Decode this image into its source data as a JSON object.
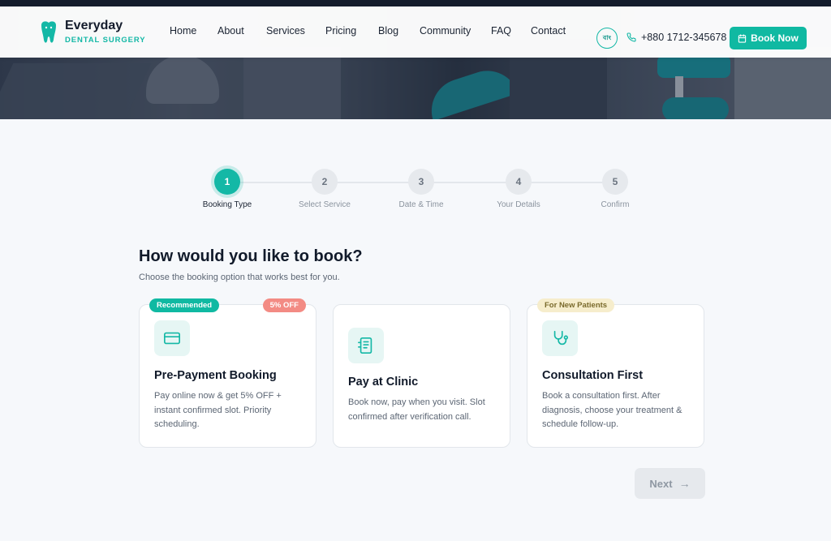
{
  "brand": {
    "name": "Everyday",
    "subtitle": "DENTAL SURGERY",
    "color": "#14b8a6"
  },
  "nav": {
    "items": [
      {
        "label": "Home"
      },
      {
        "label": "About"
      },
      {
        "label": "Services"
      },
      {
        "label": "Pricing"
      },
      {
        "label": "Blog"
      },
      {
        "label": "Community"
      },
      {
        "label": "FAQ"
      },
      {
        "label": "Contact"
      }
    ],
    "lang_label": "বাং",
    "phone": "+880 1712-345678",
    "book_now": "Book Now"
  },
  "stepper": {
    "current": 1,
    "steps": [
      {
        "number": "1",
        "label": "Booking Type"
      },
      {
        "number": "2",
        "label": "Select Service"
      },
      {
        "number": "3",
        "label": "Date & Time"
      },
      {
        "number": "4",
        "label": "Your Details"
      },
      {
        "number": "5",
        "label": "Confirm"
      }
    ]
  },
  "main": {
    "title": "How would you like to book?",
    "subtitle": "Choose the booking option that works best for you.",
    "options": [
      {
        "icon": "credit-card-icon",
        "badge_left": "Recommended",
        "badge_right": "5% OFF",
        "title": "Pre-Payment Booking",
        "description": "Pay online now & get 5% OFF + instant confirmed slot. Priority scheduling."
      },
      {
        "icon": "receipt-icon",
        "title": "Pay at Clinic",
        "description": "Book now, pay when you visit. Slot confirmed after verification call."
      },
      {
        "icon": "stethoscope-icon",
        "badge_left": "For New Patients",
        "title": "Consultation First",
        "description": "Book a consultation first. After diagnosis, choose your treatment & schedule follow-up."
      }
    ],
    "next_label": "Next"
  }
}
